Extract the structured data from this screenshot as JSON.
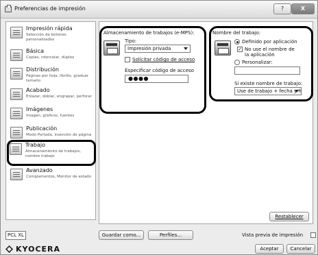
{
  "window": {
    "title": "Preferencias de impresión",
    "help_label": "?",
    "close_label": "X"
  },
  "sidebar": {
    "items": [
      {
        "title": "Impresión rápida",
        "desc": "Selección de botones personalizados"
      },
      {
        "title": "Básica",
        "desc": "Copias, intercalar, dúplex"
      },
      {
        "title": "Distribución",
        "desc": "Páginas por hoja, librillo, graduar tamaño"
      },
      {
        "title": "Acabado",
        "desc": "Enlazar, doblar, engrapar, perforar"
      },
      {
        "title": "Imágenes",
        "desc": "Imagen, gráficos, fuentes"
      },
      {
        "title": "Publicación",
        "desc": "Modo Portada, inserción de página"
      },
      {
        "title": "Trabajo",
        "desc": "Almacenamiento de trabajos, nombre trabajo"
      },
      {
        "title": "Avanzado",
        "desc": "Complementos, Monitor de estado"
      }
    ],
    "selected_index": 6,
    "pdl_badge": "PCL XL"
  },
  "storage": {
    "heading": "Almacenamiento de trabajos (e-MPS):",
    "type_label": "Tipo:",
    "type_value": "Impresión privada",
    "request_code_label": "Solicitar código de acceso",
    "request_code_checked": false,
    "specify_code_label": "Especificar código de acceso",
    "access_code_value": "●●●●"
  },
  "job_name": {
    "heading": "Nombre del trabajo:",
    "option_app": "Definido por aplicación",
    "option_app_selected": true,
    "no_use_app_name": "No use el nombre de la aplicación",
    "no_use_app_name_checked": true,
    "option_custom": "Personalizar:",
    "option_custom_selected": false,
    "custom_value": "",
    "if_exists_label": "Si existe nombre de trabajo:",
    "if_exists_value": "Use de trabajo + fecha y ho"
  },
  "buttons": {
    "restore": "Restablecer",
    "save_as": "Guardar como...",
    "profiles": "Perfiles...",
    "accept": "Aceptar",
    "cancel": "Cancelar"
  },
  "preview_label": "Vista previa de impresión",
  "preview_checked": false,
  "brand": "KYOCERA"
}
